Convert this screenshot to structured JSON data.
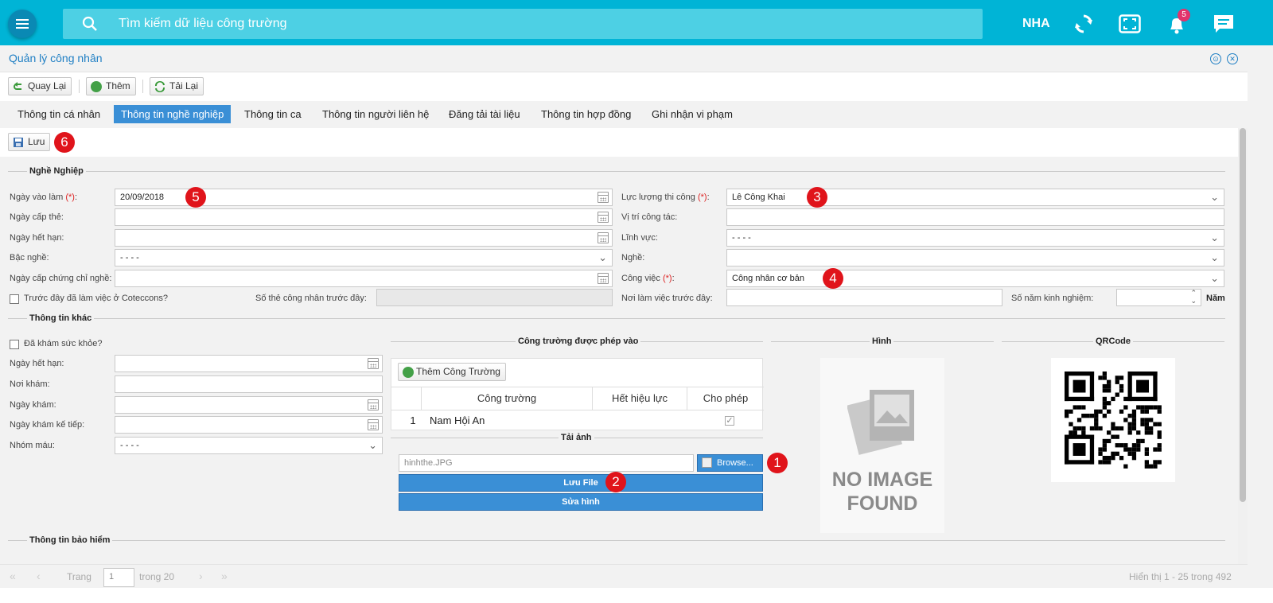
{
  "topbar": {
    "search_placeholder": "Tìm kiếm dữ liệu công trường",
    "user": "NHA",
    "notification_count": "5",
    "icons": [
      "menu-icon",
      "search-icon",
      "refresh-icon",
      "fullscreen-icon",
      "bell-icon",
      "chat-icon"
    ]
  },
  "window": {
    "title": "Quản lý công nhân"
  },
  "toolbar": {
    "back": "Quay Lại",
    "add": "Thêm",
    "reload": "Tải Lại"
  },
  "tabs": [
    "Thông tin cá nhân",
    "Thông tin nghề nghiệp",
    "Thông tin ca",
    "Thông tin người liên hệ",
    "Đăng tải tài liệu",
    "Thông tin hợp đồng",
    "Ghi nhận vi phạm"
  ],
  "active_tab": "Thông tin nghề nghiệp",
  "save": {
    "label": "Lưu",
    "marker": "6"
  },
  "career": {
    "legend": "Nghề Nghiệp",
    "start_date": {
      "label": "Ngày vào làm",
      "req": "(*)",
      "colon": ":",
      "value": "20/09/2018",
      "marker": "5"
    },
    "card_date": {
      "label": "Ngày cấp thẻ:",
      "value": ""
    },
    "expiry_date": {
      "label": "Ngày hết hạn:",
      "value": ""
    },
    "grade": {
      "label": "Bậc nghề:",
      "value": "- - - -"
    },
    "cert_date": {
      "label": "Ngày cấp chứng chỉ nghề:",
      "value": ""
    },
    "prev_coteccons": {
      "label": "Trước đây đã làm việc ở Coteccons?"
    },
    "prev_card": {
      "label": "Số thẻ công nhân trước đây:",
      "value": ""
    },
    "force": {
      "label": "Lực lượng thi công",
      "req": "(*)",
      "colon": ":",
      "value": "Lê Công Khai",
      "marker": "3"
    },
    "position": {
      "label": "Vị trí công tác:",
      "value": ""
    },
    "field": {
      "label": "Lĩnh vực:",
      "value": "- - - -"
    },
    "trade": {
      "label": "Nghề:",
      "value": ""
    },
    "job": {
      "label": "Công việc",
      "req": "(*)",
      "colon": ":",
      "value": "Công nhân cơ bản",
      "marker": "4"
    },
    "prev_work": {
      "label": "Nơi làm việc trước đây:",
      "value": ""
    },
    "experience": {
      "label": "Số năm kinh nghiệm:",
      "value": "",
      "unit": "Năm"
    }
  },
  "other": {
    "legend": "Thông tin khác",
    "health_check": {
      "label": "Đã khám sức khỏe?"
    },
    "expiry": {
      "label": "Ngày hết hạn:",
      "value": ""
    },
    "place": {
      "label": "Nơi khám:",
      "value": ""
    },
    "exam_date": {
      "label": "Ngày khám:",
      "value": ""
    },
    "next_exam": {
      "label": "Ngày khám kế tiếp:",
      "value": ""
    },
    "blood": {
      "label": "Nhóm máu:",
      "value": "- - - -"
    }
  },
  "sites": {
    "legend": "Công trường được phép vào",
    "add_button": "Thêm Công Trường",
    "columns": [
      "Công trường",
      "Hết hiệu lực",
      "Cho phép"
    ],
    "rows": [
      {
        "index": "1",
        "site": "Nam Hội An",
        "expired": "",
        "allowed": true
      }
    ]
  },
  "upload": {
    "legend": "Tải ảnh",
    "file": "hinhthe.JPG",
    "browse": "Browse...",
    "browse_marker": "1",
    "save_file": "Lưu File",
    "save_marker": "2",
    "edit": "Sửa hình"
  },
  "image": {
    "legend": "Hình",
    "placeholder_line1": "NO IMAGE",
    "placeholder_line2": "FOUND"
  },
  "qrcode": {
    "legend": "QRCode"
  },
  "insurance": {
    "legend": "Thông tin bảo hiểm"
  },
  "pager": {
    "page_label": "Trang",
    "page": "1",
    "of": "trong 20",
    "summary": "Hiển thị 1 - 25 trong 492"
  },
  "colors": {
    "topbar": "#00b4d6",
    "accent": "#3a8fd6",
    "marker": "#e0141b",
    "title": "#1f7fc4"
  }
}
